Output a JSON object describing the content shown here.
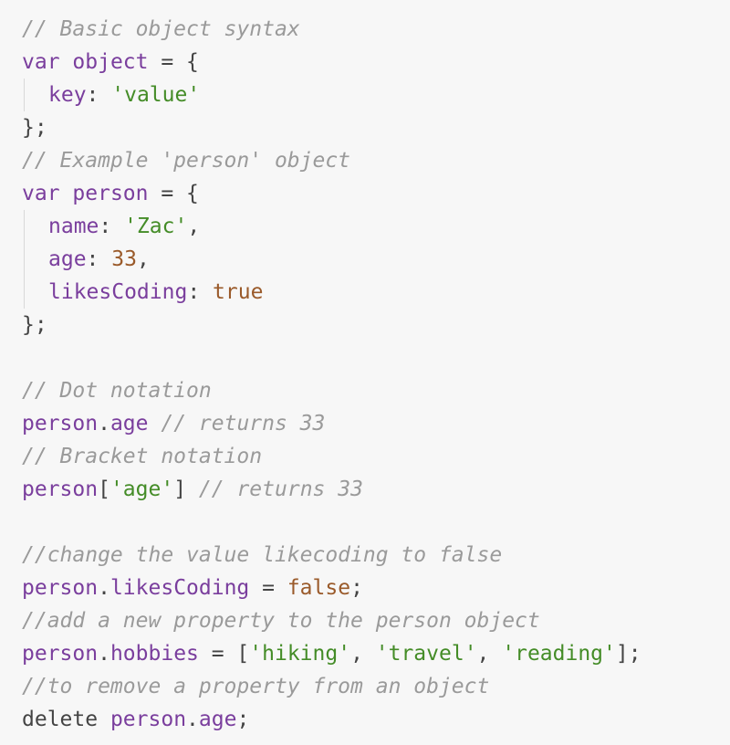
{
  "colors": {
    "background": "#f7f7f7",
    "comment": "#9a9a9a",
    "keyword": "#7a3e9d",
    "string": "#448c27",
    "number": "#9a5a2a",
    "punct": "#444444"
  },
  "lines": [
    {
      "indent": false,
      "tokens": [
        {
          "type": "comment",
          "text": "// Basic object syntax"
        }
      ]
    },
    {
      "indent": false,
      "tokens": [
        {
          "type": "keyword",
          "text": "var"
        },
        {
          "type": "plain",
          "text": " "
        },
        {
          "type": "var",
          "text": "object"
        },
        {
          "type": "punct",
          "text": " = {"
        }
      ]
    },
    {
      "indent": true,
      "tokens": [
        {
          "type": "prop",
          "text": "key"
        },
        {
          "type": "punct",
          "text": ": "
        },
        {
          "type": "string",
          "text": "'value'"
        }
      ]
    },
    {
      "indent": false,
      "tokens": [
        {
          "type": "punct",
          "text": "};"
        }
      ]
    },
    {
      "indent": false,
      "tokens": [
        {
          "type": "comment",
          "text": "// Example 'person' object"
        }
      ]
    },
    {
      "indent": false,
      "tokens": [
        {
          "type": "keyword",
          "text": "var"
        },
        {
          "type": "plain",
          "text": " "
        },
        {
          "type": "var",
          "text": "person"
        },
        {
          "type": "punct",
          "text": " = {"
        }
      ]
    },
    {
      "indent": true,
      "tokens": [
        {
          "type": "prop",
          "text": "name"
        },
        {
          "type": "punct",
          "text": ": "
        },
        {
          "type": "string",
          "text": "'Zac'"
        },
        {
          "type": "punct",
          "text": ","
        }
      ]
    },
    {
      "indent": true,
      "tokens": [
        {
          "type": "prop",
          "text": "age"
        },
        {
          "type": "punct",
          "text": ": "
        },
        {
          "type": "number",
          "text": "33"
        },
        {
          "type": "punct",
          "text": ","
        }
      ]
    },
    {
      "indent": true,
      "tokens": [
        {
          "type": "prop",
          "text": "likesCoding"
        },
        {
          "type": "punct",
          "text": ": "
        },
        {
          "type": "bool",
          "text": "true"
        }
      ]
    },
    {
      "indent": false,
      "tokens": [
        {
          "type": "punct",
          "text": "};"
        }
      ]
    },
    {
      "indent": false,
      "tokens": []
    },
    {
      "indent": false,
      "tokens": [
        {
          "type": "comment",
          "text": "// Dot notation"
        }
      ]
    },
    {
      "indent": false,
      "tokens": [
        {
          "type": "var",
          "text": "person"
        },
        {
          "type": "punct",
          "text": "."
        },
        {
          "type": "prop",
          "text": "age"
        },
        {
          "type": "plain",
          "text": " "
        },
        {
          "type": "comment",
          "text": "// returns 33"
        }
      ]
    },
    {
      "indent": false,
      "tokens": [
        {
          "type": "comment",
          "text": "// Bracket notation"
        }
      ]
    },
    {
      "indent": false,
      "tokens": [
        {
          "type": "var",
          "text": "person"
        },
        {
          "type": "punct",
          "text": "["
        },
        {
          "type": "string",
          "text": "'age'"
        },
        {
          "type": "punct",
          "text": "]"
        },
        {
          "type": "plain",
          "text": " "
        },
        {
          "type": "comment",
          "text": "// returns 33"
        }
      ]
    },
    {
      "indent": false,
      "tokens": []
    },
    {
      "indent": false,
      "tokens": [
        {
          "type": "comment",
          "text": "//change the value likecoding to false"
        }
      ]
    },
    {
      "indent": false,
      "tokens": [
        {
          "type": "var",
          "text": "person"
        },
        {
          "type": "punct",
          "text": "."
        },
        {
          "type": "prop",
          "text": "likesCoding"
        },
        {
          "type": "punct",
          "text": " = "
        },
        {
          "type": "bool",
          "text": "false"
        },
        {
          "type": "punct",
          "text": ";"
        }
      ]
    },
    {
      "indent": false,
      "tokens": [
        {
          "type": "comment",
          "text": "//add a new property to the person object"
        }
      ]
    },
    {
      "indent": false,
      "tokens": [
        {
          "type": "var",
          "text": "person"
        },
        {
          "type": "punct",
          "text": "."
        },
        {
          "type": "prop",
          "text": "hobbies"
        },
        {
          "type": "punct",
          "text": " = ["
        },
        {
          "type": "string",
          "text": "'hiking'"
        },
        {
          "type": "punct",
          "text": ", "
        },
        {
          "type": "string",
          "text": "'travel'"
        },
        {
          "type": "punct",
          "text": ", "
        },
        {
          "type": "string",
          "text": "'reading'"
        },
        {
          "type": "punct",
          "text": "];"
        }
      ]
    },
    {
      "indent": false,
      "tokens": [
        {
          "type": "comment",
          "text": "//to remove a property from an object"
        }
      ]
    },
    {
      "indent": false,
      "tokens": [
        {
          "type": "plain",
          "text": "delete"
        },
        {
          "type": "plain",
          "text": " "
        },
        {
          "type": "var",
          "text": "person"
        },
        {
          "type": "punct",
          "text": "."
        },
        {
          "type": "prop",
          "text": "age"
        },
        {
          "type": "punct",
          "text": ";"
        }
      ]
    }
  ]
}
